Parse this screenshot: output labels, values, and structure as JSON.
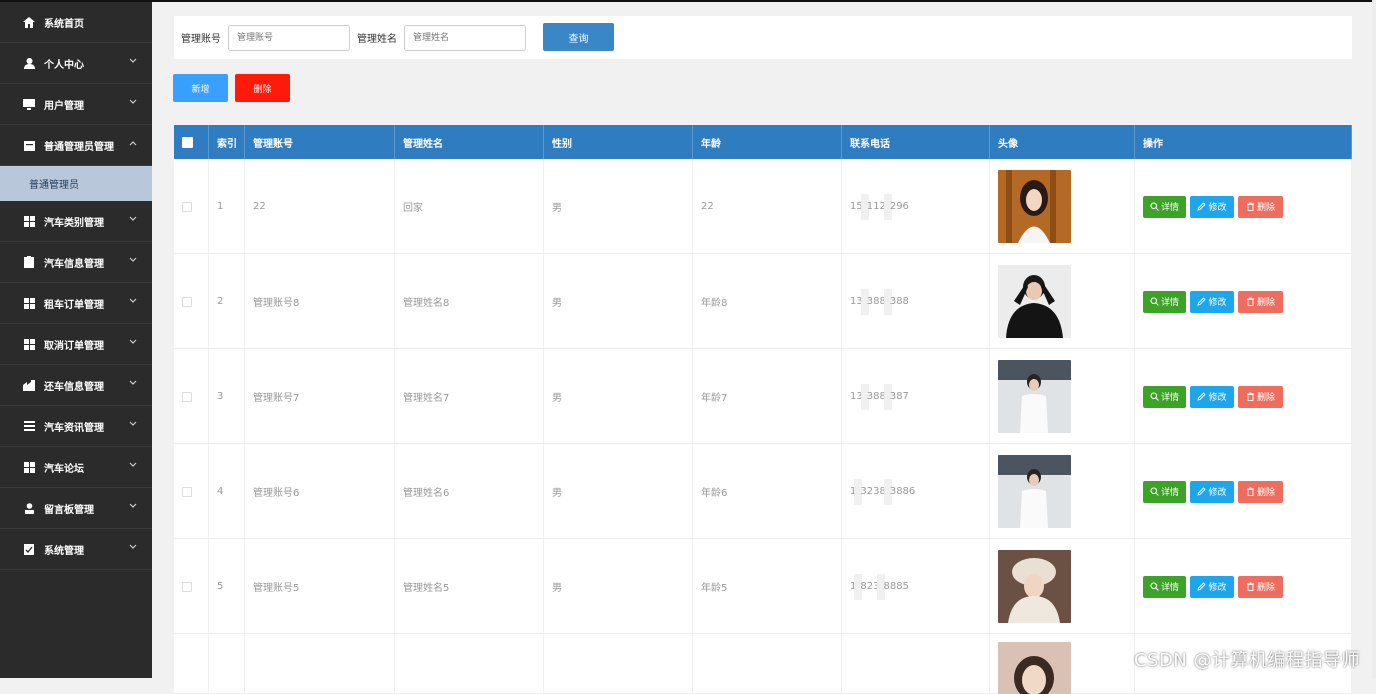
{
  "sidebar": {
    "items": [
      {
        "label": "系统首页",
        "icon": "home-icon",
        "has_chevron": false
      },
      {
        "label": "个人中心",
        "icon": "user-icon",
        "has_chevron": true
      },
      {
        "label": "用户管理",
        "icon": "monitor-icon",
        "has_chevron": true
      },
      {
        "label": "普通管理员管理",
        "icon": "calendar-icon",
        "has_chevron": true,
        "expanded": true
      },
      {
        "label": "汽车类别管理",
        "icon": "grid-icon",
        "has_chevron": true
      },
      {
        "label": "汽车信息管理",
        "icon": "clipboard-icon",
        "has_chevron": true
      },
      {
        "label": "租车订单管理",
        "icon": "grid-icon",
        "has_chevron": true
      },
      {
        "label": "取消订单管理",
        "icon": "grid-icon",
        "has_chevron": true
      },
      {
        "label": "还车信息管理",
        "icon": "building-icon",
        "has_chevron": true
      },
      {
        "label": "汽车资讯管理",
        "icon": "list-icon",
        "has_chevron": true
      },
      {
        "label": "汽车论坛",
        "icon": "grid-icon",
        "has_chevron": true
      },
      {
        "label": "留言板管理",
        "icon": "person-icon",
        "has_chevron": true
      },
      {
        "label": "系统管理",
        "icon": "clipboard-check-icon",
        "has_chevron": true
      }
    ],
    "submenu_label": "普通管理员"
  },
  "search": {
    "account_label": "管理账号",
    "account_placeholder": "管理账号",
    "name_label": "管理姓名",
    "name_placeholder": "管理姓名",
    "query_button": "查询"
  },
  "actions": {
    "add": "新增",
    "delete": "删除"
  },
  "table": {
    "headers": [
      "索引",
      "管理账号",
      "管理姓名",
      "性别",
      "年龄",
      "联系电话",
      "头像",
      "操作"
    ],
    "rows": [
      {
        "index": "1",
        "account": "22",
        "name": "回家",
        "gender": "男",
        "age": "22",
        "phone_a": "15",
        "phone_b": "112",
        "phone_c": "296"
      },
      {
        "index": "2",
        "account": "管理账号8",
        "name": "管理姓名8",
        "gender": "男",
        "age": "年龄8",
        "phone_a": "13",
        "phone_b": "388",
        "phone_c": "388"
      },
      {
        "index": "3",
        "account": "管理账号7",
        "name": "管理姓名7",
        "gender": "男",
        "age": "年龄7",
        "phone_a": "13",
        "phone_b": "388",
        "phone_c": "387"
      },
      {
        "index": "4",
        "account": "管理账号6",
        "name": "管理姓名6",
        "gender": "男",
        "age": "年龄6",
        "phone_a": "1",
        "phone_b": "3238",
        "phone_c": "3886"
      },
      {
        "index": "5",
        "account": "管理账号5",
        "name": "管理姓名5",
        "gender": "男",
        "age": "年龄5",
        "phone_a": "1",
        "phone_b": "823",
        "phone_c": "8885"
      }
    ],
    "op_labels": {
      "detail": "详情",
      "edit": "修改",
      "delete": "删除"
    }
  },
  "watermark": "CSDN @计算机编程指导师",
  "colors": {
    "header_blue": "#2f7cc0",
    "sidebar_bg": "#2b2b2b",
    "detail_green": "#3ca228",
    "edit_blue": "#1ea6ec",
    "delete_red": "#ef6d5e"
  }
}
